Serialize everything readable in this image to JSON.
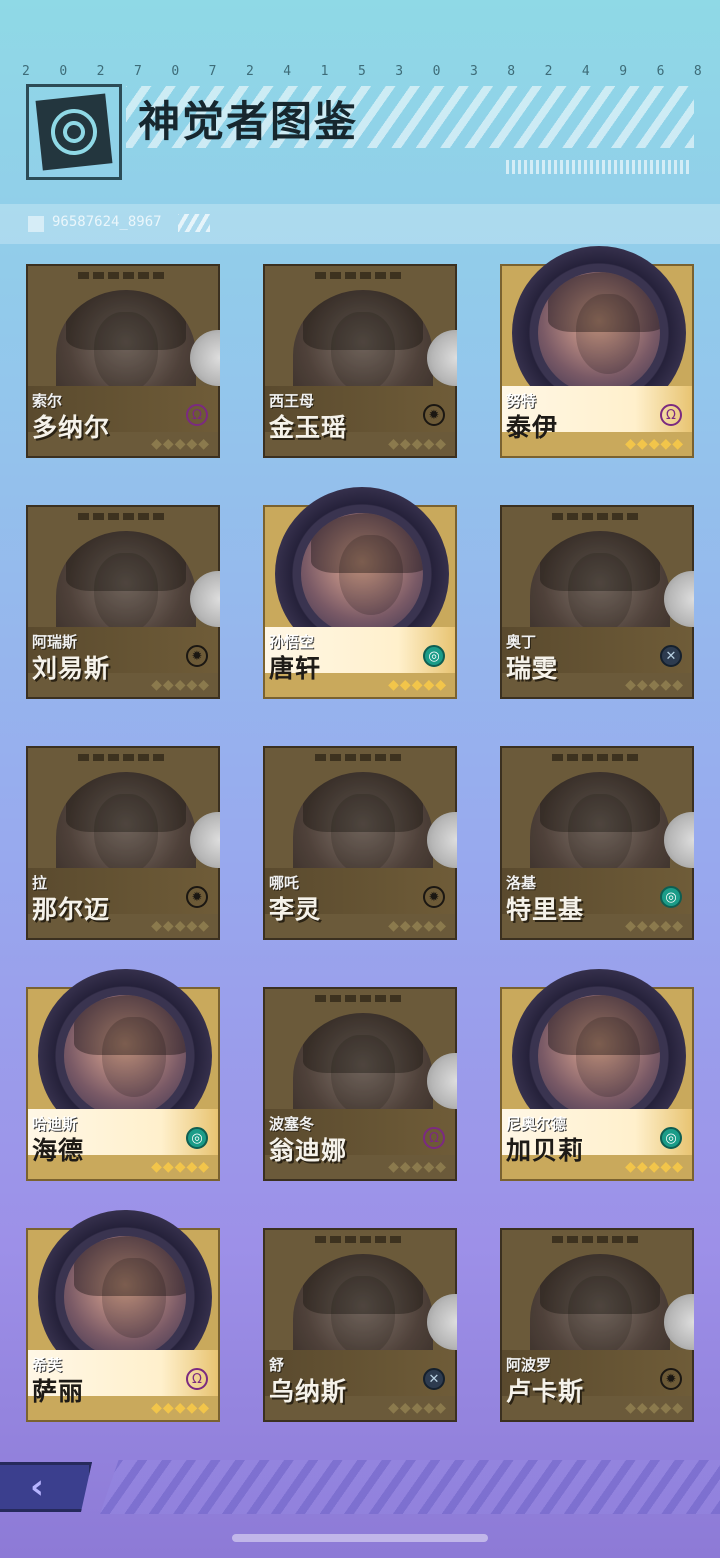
{
  "header": {
    "digits": [
      "2",
      "0",
      "2",
      "7",
      "0",
      "7",
      "2",
      "4",
      "1",
      "5",
      "3",
      "0",
      "3",
      "8",
      "2",
      "4",
      "9",
      "6",
      "8"
    ],
    "title": "神觉者图鉴",
    "sub_code": "96587624_8967"
  },
  "cards": [
    {
      "small": "索尔",
      "name": "多纳尔",
      "emblem": "Ω",
      "stars": "◆◆◆◆◆",
      "active": false
    },
    {
      "small": "西王母",
      "name": "金玉瑶",
      "emblem": "✹",
      "stars": "◆◆◆◆◆",
      "active": false
    },
    {
      "small": "努特",
      "name": "泰伊",
      "emblem": "Ω",
      "stars": "◆◆◆◆◆",
      "active": true
    },
    {
      "small": "阿瑞斯",
      "name": "刘易斯",
      "emblem": "✹",
      "stars": "◆◆◆◆◆",
      "active": false
    },
    {
      "small": "孙悟空",
      "name": "唐轩",
      "emblem": "◎",
      "stars": "◆◆◆◆◆",
      "active": true
    },
    {
      "small": "奥丁",
      "name": "瑞雯",
      "emblem": "✕",
      "stars": "◆◆◆◆◆",
      "active": false
    },
    {
      "small": "拉",
      "name": "那尔迈",
      "emblem": "✹",
      "stars": "◆◆◆◆◆",
      "active": false
    },
    {
      "small": "哪吒",
      "name": "李灵",
      "emblem": "✹",
      "stars": "◆◆◆◆◆",
      "active": false
    },
    {
      "small": "洛基",
      "name": "特里基",
      "emblem": "◎",
      "stars": "◆◆◆◆◆",
      "active": false
    },
    {
      "small": "哈迪斯",
      "name": "海德",
      "emblem": "◎",
      "stars": "◆◆◆◆◆",
      "active": true
    },
    {
      "small": "波塞冬",
      "name": "翁迪娜",
      "emblem": "Ω",
      "stars": "◆◆◆◆◆",
      "active": false
    },
    {
      "small": "尼奥尔德",
      "name": "加贝莉",
      "emblem": "◎",
      "stars": "◆◆◆◆◆",
      "active": true
    },
    {
      "small": "希芙",
      "name": "萨丽",
      "emblem": "Ω",
      "stars": "◆◆◆◆◆",
      "active": true
    },
    {
      "small": "舒",
      "name": "乌纳斯",
      "emblem": "✕",
      "stars": "◆◆◆◆◆",
      "active": false
    },
    {
      "small": "阿波罗",
      "name": "卢卡斯",
      "emblem": "✹",
      "stars": "◆◆◆◆◆",
      "active": false
    }
  ],
  "nav": {
    "back_icon": "‹"
  }
}
